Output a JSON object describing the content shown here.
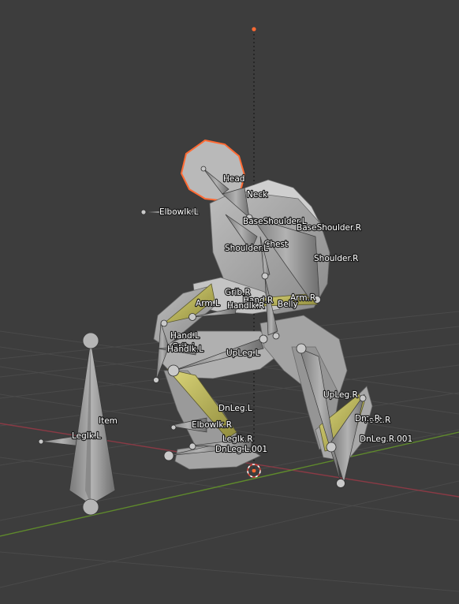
{
  "viewport": {
    "bone_labels": [
      "Head",
      "Neck",
      "ElbowIk.L",
      "BaseShoulder.L",
      "BaseShoulder.R",
      "Chest",
      "Shoulder.L",
      "Shoulder.R",
      "Grib.R",
      "Hand.R",
      "HandIk.R",
      "Arm.L",
      "Arm.R",
      "Belly",
      "Hand.L",
      "Grib.L",
      "HandIk.L",
      "UpLeg.L",
      "UpLeg.R",
      "Item",
      "LegIk.L",
      "DnLeg.L",
      "ElbowIk.R",
      "LegIk.R",
      "DnLeg.L.001",
      "Foot.R",
      "Dn...R",
      "DnLeg.R.001"
    ],
    "colors": {
      "background": "#3d3d3d",
      "grid_line": "#4a4a4a",
      "x_axis": "#8a3a45",
      "y_axis": "#5f8a2c",
      "mesh": "#a8a8a8",
      "bone": "#9a9a9a",
      "selected_bone": "#c8c264",
      "selection_outline": "#ff6a33",
      "cursor": "#ffffff"
    },
    "icons": [
      "3d-cursor-icon",
      "object-origin-icon"
    ]
  }
}
